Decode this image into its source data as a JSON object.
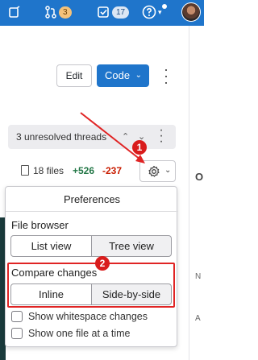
{
  "topbar": {
    "issues_icon": "issues-icon",
    "merge_requests_count": "3",
    "todos_count": "17",
    "help_icon": "help-icon"
  },
  "actions": {
    "edit_label": "Edit",
    "code_label": "Code"
  },
  "threads": {
    "label": "3 unresolved threads"
  },
  "files": {
    "count_label": "18 files",
    "added": "+526",
    "removed": "-237"
  },
  "preferences": {
    "title": "Preferences",
    "file_browser": {
      "label": "File browser",
      "options": [
        "List view",
        "Tree view"
      ],
      "selected": "Tree view"
    },
    "compare_changes": {
      "label": "Compare changes",
      "options": [
        "Inline",
        "Side-by-side"
      ],
      "selected": "Side-by-side"
    },
    "checkboxes": [
      {
        "label": "Show whitespace changes",
        "checked": false
      },
      {
        "label": "Show one file at a time",
        "checked": false
      }
    ]
  },
  "annotations": {
    "step1": "1",
    "step2": "2",
    "color": "#e02424"
  },
  "side_fragments": {
    "n": "N",
    "a": "A",
    "o": "O"
  },
  "colors": {
    "brand_blue": "#1f75cb",
    "added_green": "#217645",
    "removed_red": "#c91c00"
  }
}
